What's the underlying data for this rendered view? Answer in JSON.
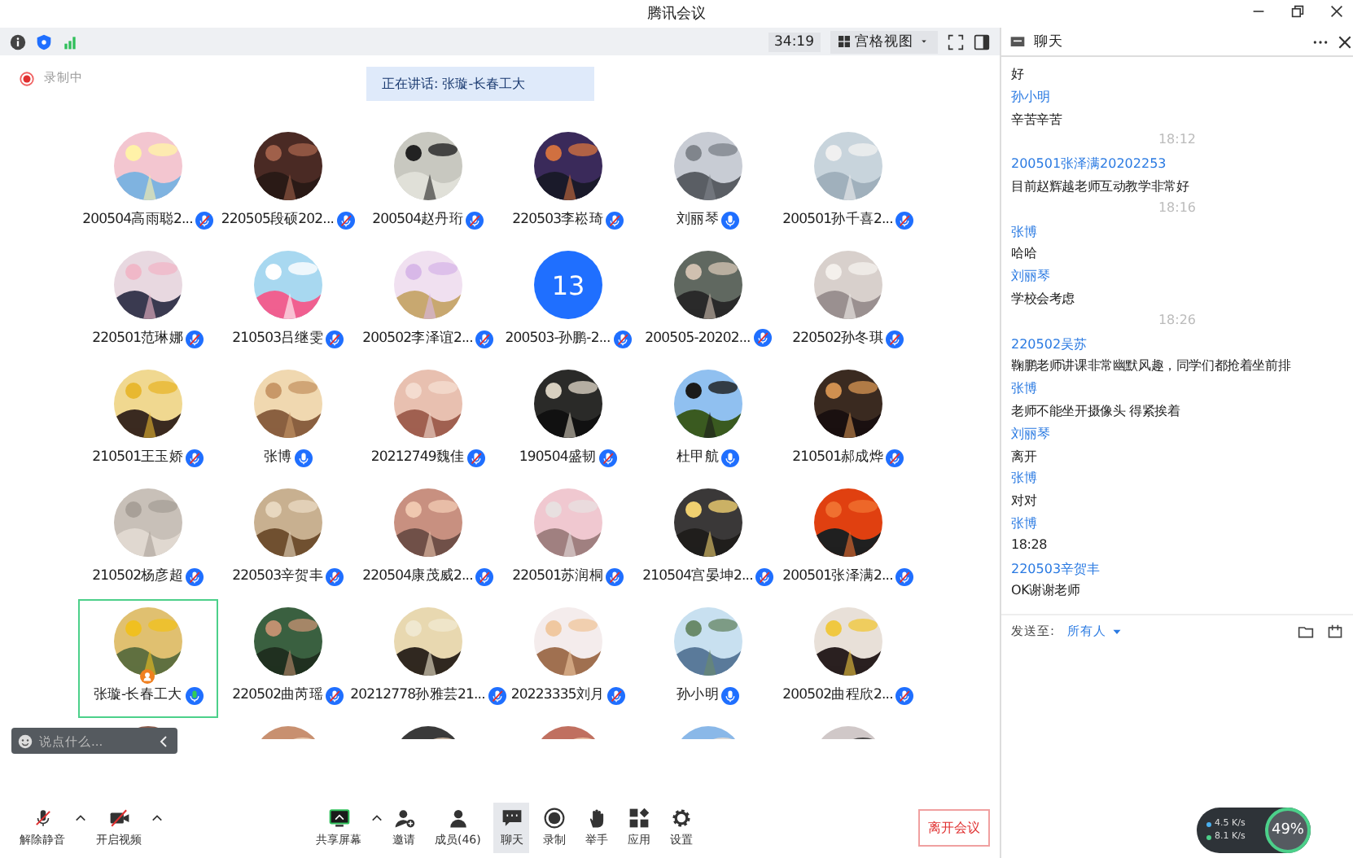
{
  "window": {
    "title": "腾讯会议"
  },
  "toolbar": {
    "timer": "34:19",
    "view_button": "宫格视图"
  },
  "recording": {
    "label": "录制中"
  },
  "speaking_banner": "正在讲话: 张璇-长春工大",
  "participants": [
    {
      "name": "200504高雨聪2...",
      "kind": "picture",
      "muted": true,
      "speaking": false,
      "selected": false
    },
    {
      "name": "220505段硕202...",
      "kind": "picture",
      "muted": true,
      "speaking": false,
      "selected": false
    },
    {
      "name": "200504赵丹珩",
      "kind": "picture",
      "muted": true,
      "speaking": false,
      "selected": false
    },
    {
      "name": "220503李崧琦",
      "kind": "picture",
      "muted": true,
      "speaking": false,
      "selected": false
    },
    {
      "name": "刘丽琴",
      "kind": "picture",
      "muted": false,
      "speaking": false,
      "selected": false
    },
    {
      "name": "200501孙千喜2...",
      "kind": "picture",
      "muted": true,
      "speaking": false,
      "selected": false
    },
    {
      "name": "220501范琳娜",
      "kind": "picture",
      "muted": true,
      "speaking": false,
      "selected": false
    },
    {
      "name": "210503吕继雯",
      "kind": "picture",
      "muted": true,
      "speaking": false,
      "selected": false
    },
    {
      "name": "200502李泽谊2...",
      "kind": "picture",
      "muted": true,
      "speaking": false,
      "selected": false
    },
    {
      "name": "200503-孙鹏-2...",
      "kind": "number",
      "avatar_text": "13",
      "muted": true,
      "speaking": false,
      "selected": false
    },
    {
      "name": "200505-20202...",
      "kind": "picture",
      "muted": true,
      "speaking": false,
      "selected": false
    },
    {
      "name": "220502孙冬琪",
      "kind": "picture",
      "muted": true,
      "speaking": false,
      "selected": false
    },
    {
      "name": "210501王玉娇",
      "kind": "picture",
      "muted": true,
      "speaking": false,
      "selected": false
    },
    {
      "name": "张博",
      "kind": "picture",
      "muted": false,
      "speaking": false,
      "selected": false
    },
    {
      "name": "20212749魏佳",
      "kind": "picture",
      "muted": true,
      "speaking": false,
      "selected": false
    },
    {
      "name": "190504盛韧",
      "kind": "picture",
      "muted": true,
      "speaking": false,
      "selected": false
    },
    {
      "name": "杜甲航",
      "kind": "picture",
      "muted": false,
      "speaking": false,
      "selected": false
    },
    {
      "name": "210501郝成烨",
      "kind": "picture",
      "muted": true,
      "speaking": false,
      "selected": false
    },
    {
      "name": "210502杨彦超",
      "kind": "picture",
      "muted": true,
      "speaking": false,
      "selected": false
    },
    {
      "name": "220503辛贺丰",
      "kind": "picture",
      "muted": true,
      "speaking": false,
      "selected": false
    },
    {
      "name": "220504康茂威2...",
      "kind": "picture",
      "muted": true,
      "speaking": false,
      "selected": false
    },
    {
      "name": "220501苏润桐",
      "kind": "picture",
      "muted": true,
      "speaking": false,
      "selected": false
    },
    {
      "name": "210504宫晏坤2...",
      "kind": "picture",
      "muted": true,
      "speaking": false,
      "selected": false
    },
    {
      "name": "200501张泽满2...",
      "kind": "picture",
      "muted": true,
      "speaking": false,
      "selected": false
    },
    {
      "name": "张璇-长春工大",
      "kind": "picture",
      "muted": false,
      "speaking": true,
      "selected": true
    },
    {
      "name": "220502曲芮瑶",
      "kind": "picture",
      "muted": true,
      "speaking": false,
      "selected": false
    },
    {
      "name": "20212778孙雅芸21...",
      "kind": "picture",
      "muted": true,
      "speaking": false,
      "selected": false
    },
    {
      "name": "20223335刘月",
      "kind": "picture",
      "muted": true,
      "speaking": false,
      "selected": false
    },
    {
      "name": "孙小明",
      "kind": "picture",
      "muted": false,
      "speaking": false,
      "selected": false
    },
    {
      "name": "200502曲程欣2...",
      "kind": "picture",
      "muted": true,
      "speaking": false,
      "selected": false
    }
  ],
  "quick_chat": {
    "placeholder": "说点什么..."
  },
  "bottom_bar": [
    {
      "label": "解除静音",
      "caret": true,
      "selected": false
    },
    {
      "label": "开启视频",
      "caret": true,
      "selected": false
    },
    {
      "label": "共享屏幕",
      "caret": true,
      "selected": false
    },
    {
      "label": "邀请",
      "caret": false,
      "selected": false
    },
    {
      "label": "成员(46)",
      "caret": false,
      "selected": false
    },
    {
      "label": "聊天",
      "caret": false,
      "selected": true
    },
    {
      "label": "录制",
      "caret": false,
      "selected": false
    },
    {
      "label": "举手",
      "caret": false,
      "selected": false
    },
    {
      "label": "应用",
      "caret": false,
      "selected": false
    },
    {
      "label": "设置",
      "caret": false,
      "selected": false
    }
  ],
  "leave_button": "离开会议",
  "network": {
    "upload": "4.5 K/s",
    "download": "8.1 K/s",
    "cpu": "49%"
  },
  "chat": {
    "title": "聊天",
    "messages": [
      {
        "kind": "text",
        "text": "好"
      },
      {
        "kind": "sender",
        "text": "孙小明"
      },
      {
        "kind": "text",
        "text": "辛苦辛苦"
      },
      {
        "kind": "time",
        "text": "18:12"
      },
      {
        "kind": "sender",
        "text": "200501张泽满20202253"
      },
      {
        "kind": "text",
        "text": "目前赵辉越老师互动教学非常好"
      },
      {
        "kind": "time",
        "text": "18:16"
      },
      {
        "kind": "sender",
        "text": "张博"
      },
      {
        "kind": "text",
        "text": "哈哈"
      },
      {
        "kind": "sender",
        "text": "刘丽琴"
      },
      {
        "kind": "text",
        "text": "学校会考虑"
      },
      {
        "kind": "time",
        "text": "18:26"
      },
      {
        "kind": "sender",
        "text": "220502吴苏"
      },
      {
        "kind": "text",
        "text": "鞠鹏老师讲课非常幽默风趣，同学们都抢着坐前排"
      },
      {
        "kind": "sender",
        "text": "张博"
      },
      {
        "kind": "text",
        "text": "老师不能坐开摄像头 得紧挨着"
      },
      {
        "kind": "sender",
        "text": "刘丽琴"
      },
      {
        "kind": "text",
        "text": "离开"
      },
      {
        "kind": "sender",
        "text": "张博"
      },
      {
        "kind": "text",
        "text": "对对"
      },
      {
        "kind": "sender",
        "text": "张博"
      },
      {
        "kind": "text",
        "text": "18:28"
      },
      {
        "kind": "sender",
        "text": "220503辛贺丰"
      },
      {
        "kind": "text",
        "text": "OK谢谢老师"
      }
    ],
    "send_to_label": "发送至:",
    "send_to_value": "所有人"
  }
}
